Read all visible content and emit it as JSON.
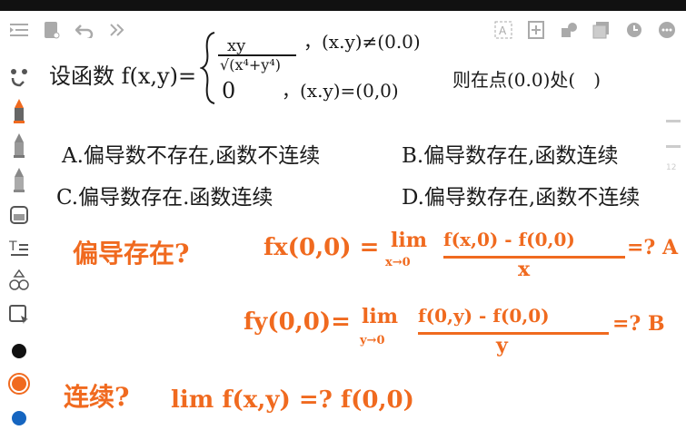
{
  "toolbar": {
    "left_icons": [
      "list-indent-icon",
      "tablet-icon",
      "undo-icon",
      "expand-icon"
    ],
    "right_icons": [
      "text-recognize-icon",
      "page-add-icon",
      "shapes-icon",
      "layers-icon",
      "clock-icon",
      "more-icon"
    ]
  },
  "problem": {
    "intro": "设函数 f(x,y)=",
    "case1_num": "xy",
    "case1_den": "√(x⁴+y⁴)",
    "case1_cond": "，(x.y)≠(0.0)",
    "case2_val": "0",
    "case2_cond": "，(x.y)=(0,0)",
    "question": "则在点(0.0)处(　)"
  },
  "options": {
    "a": "A.偏导数不存在,函数不连续",
    "b": "B.偏导数存在,函数连续",
    "c": "C.偏导数存在.函数连续",
    "d": "D.偏导数存在,函数不连续"
  },
  "notes": {
    "partial_q": "偏导存在?",
    "fx_lhs": "fx(0,0) =",
    "lim": "lim",
    "fx_sub": "x→0",
    "fx_num": "f(x,0) - f(0,0)",
    "fx_den": "x",
    "fx_rhs": "=? A",
    "fy_lhs": "fy(0,0)=",
    "fy_sub": "y→0",
    "fy_num": "f(0,y) - f(0,0)",
    "fy_den": "y",
    "fy_rhs": "=? B",
    "cont_q": "连续?",
    "cont_expr": "lim f(x,y) =? f(0,0)"
  },
  "scroll": {
    "page_label": "12"
  },
  "colors": {
    "ink_black": "#1a1a1a",
    "ink_orange": "#f06a1f",
    "pen_blue": "#1565c0"
  }
}
